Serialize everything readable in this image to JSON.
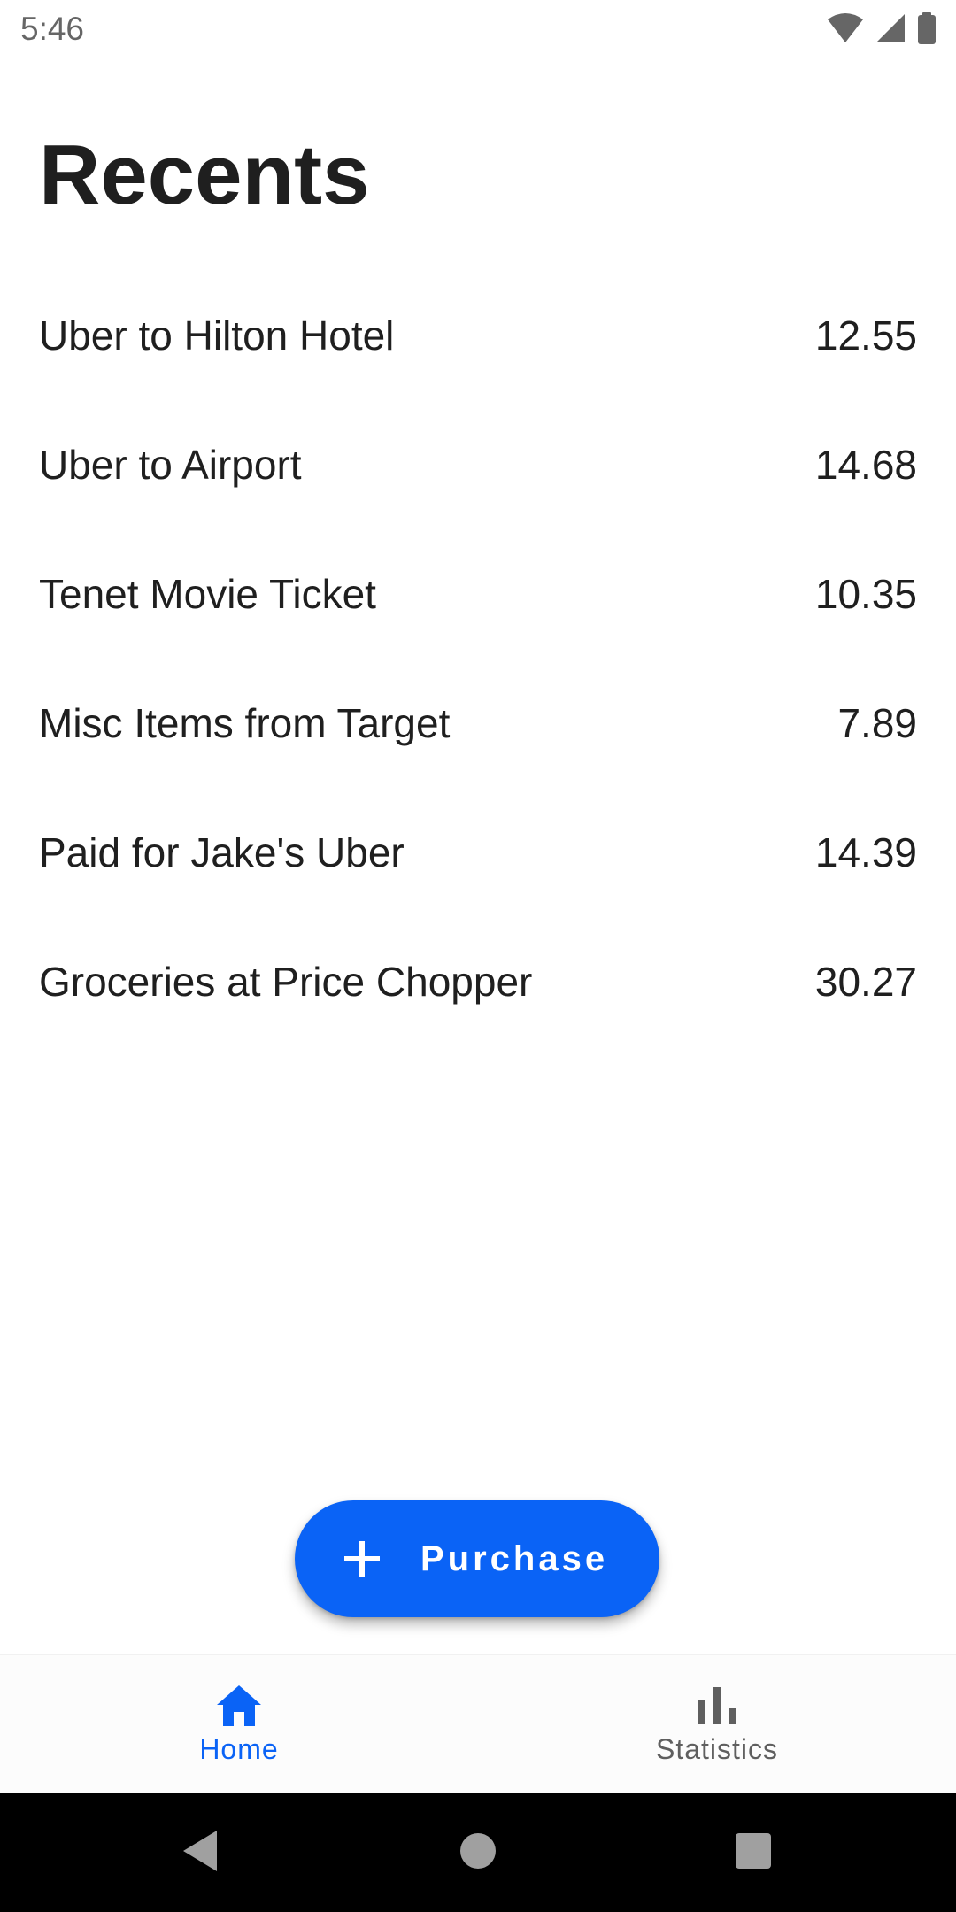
{
  "status_bar": {
    "time": "5:46",
    "icons": [
      "wifi-icon",
      "cell-signal-icon",
      "battery-icon"
    ]
  },
  "page": {
    "title": "Recents"
  },
  "purchases": [
    {
      "name": "Uber to Hilton Hotel",
      "amount": "12.55"
    },
    {
      "name": "Uber to Airport",
      "amount": "14.68"
    },
    {
      "name": "Tenet Movie Ticket",
      "amount": "10.35"
    },
    {
      "name": "Misc Items from Target",
      "amount": "7.89"
    },
    {
      "name": "Paid for Jake's Uber",
      "amount": "14.39"
    },
    {
      "name": "Groceries at Price Chopper",
      "amount": "30.27"
    }
  ],
  "fab": {
    "icon": "plus-icon",
    "label": "Purchase"
  },
  "bottom_nav": {
    "items": [
      {
        "label": "Home",
        "icon": "home-icon",
        "active": true
      },
      {
        "label": "Statistics",
        "icon": "bar-chart-icon",
        "active": false
      }
    ]
  },
  "system_nav": {
    "icons": [
      "back-icon",
      "home-circle-icon",
      "recents-square-icon"
    ]
  },
  "colors": {
    "accent": "#0a63f6",
    "text_primary": "#1f1f1f",
    "text_secondary": "#5f5f5f"
  }
}
